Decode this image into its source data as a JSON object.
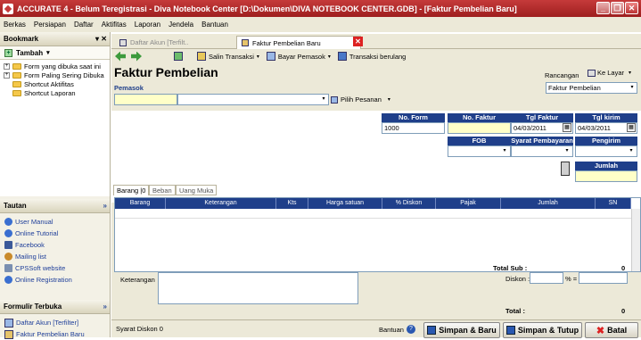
{
  "window": {
    "title": "ACCURATE 4  - Belum Teregistrasi - Diva Notebook Center   [D:\\Dokumen\\DIVA NOTEBOOK CENTER.GDB] - [Faktur Pembelian Baru]"
  },
  "menu": [
    "Berkas",
    "Persiapan",
    "Daftar",
    "Aktifitas",
    "Laporan",
    "Jendela",
    "Bantuan"
  ],
  "bookmark": {
    "title": "Bookmark",
    "tambah": "Tambah",
    "tree": [
      "Form yang dibuka saat ini",
      "Form Paling Sering Dibuka",
      "Shortcut Aktifitas",
      "Shortcut Laporan"
    ]
  },
  "tautan": {
    "title": "Tautan",
    "links": [
      "User Manual",
      "Online Tutorial",
      "Facebook",
      "Mailing list",
      "CPSSoft website",
      "Online Registration"
    ]
  },
  "formulir": {
    "title": "Formulir Terbuka",
    "items": [
      "Daftar Akun [Terfilter]",
      "Faktur Pembelian Baru"
    ]
  },
  "tabs": [
    "Daftar Akun [Terfilt..",
    "Faktur Pembelian Baru"
  ],
  "toolbar": {
    "salin": "Salin Transaksi",
    "bayar": "Bayar Pemasok",
    "berulang": "Transaksi berulang"
  },
  "form": {
    "title": "Faktur Pembelian",
    "pemasok_label": "Pemasok",
    "pilih_pesanan": "Pilih Pesanan",
    "rancangan_label": "Rancangan",
    "ke_layar": "Ke Layar",
    "rancangan_value": "Faktur Pembelian",
    "no_form_label": "No. Form",
    "no_form_value": "1000",
    "no_faktur_label": "No. Faktur",
    "tgl_faktur_label": "Tgl Faktur",
    "tgl_faktur_value": "04/03/2011",
    "tgl_kirim_label": "Tgl kirim",
    "tgl_kirim_value": "04/03/2011",
    "fob_label": "FOB",
    "syarat_label": "Syarat Pembayaran",
    "pengirim_label": "Pengirim",
    "jumlah_label": "Jumlah"
  },
  "detail_tabs": [
    "Barang |0",
    "Beban",
    "Uang Muka"
  ],
  "grid_columns": [
    "Barang",
    "Keterangan",
    "Kts",
    "Harga satuan",
    "% Diskon",
    "Pajak",
    "Jumlah",
    "SN"
  ],
  "footer": {
    "keterangan_label": "Keterangan",
    "total_sub_label": "Total Sub :",
    "total_sub_value": "0",
    "diskon_label": "Diskon :",
    "percent_eq": "% =",
    "total_label": "Total :",
    "total_value": "0",
    "syarat_diskon": "Syarat Diskon 0",
    "bantuan": "Bantuan",
    "simpan_baru": "Simpan & Baru",
    "simpan_tutup": "Simpan & Tutup",
    "batal": "Batal"
  }
}
